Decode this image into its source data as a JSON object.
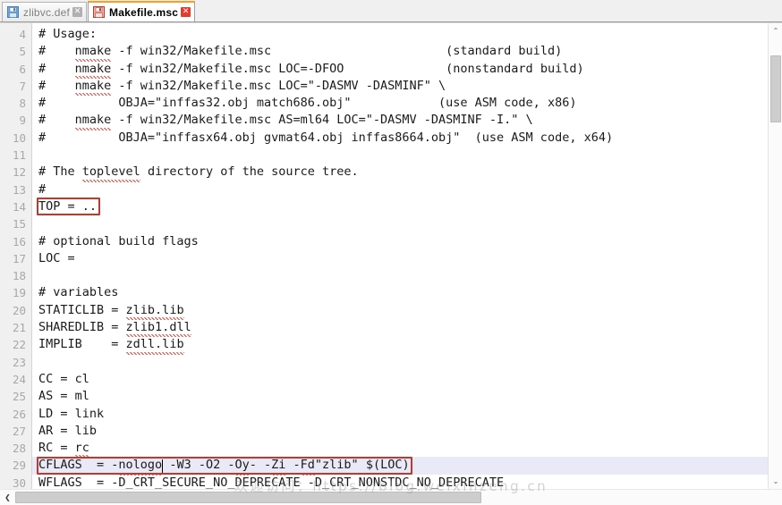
{
  "window": {
    "app_kind": "text-editor",
    "accent_active_tab": "#ff9b27",
    "annotation_color": "#c0392b",
    "current_line_color": "#e9e9f7"
  },
  "tabs": [
    {
      "label": "zlibvc.def",
      "icon": "save-disk-icon",
      "close": "✕",
      "active": false
    },
    {
      "label": "Makefile.msc",
      "icon": "save-disk-icon",
      "close": "✕",
      "active": true
    }
  ],
  "editor": {
    "first_line_number": 4,
    "current_line_number": 29,
    "lines": [
      {
        "n": 4,
        "text": "# Usage:"
      },
      {
        "n": 5,
        "text": "#    nmake -f win32/Makefile.msc                        (standard build)"
      },
      {
        "n": 6,
        "text": "#    nmake -f win32/Makefile.msc LOC=-DFOO              (nonstandard build)"
      },
      {
        "n": 7,
        "text": "#    nmake -f win32/Makefile.msc LOC=\"-DASMV -DASMINF\" \\"
      },
      {
        "n": 8,
        "text": "#          OBJA=\"inffas32.obj match686.obj\"            (use ASM code, x86)"
      },
      {
        "n": 9,
        "text": "#    nmake -f win32/Makefile.msc AS=ml64 LOC=\"-DASMV -DASMINF -I.\" \\"
      },
      {
        "n": 10,
        "text": "#          OBJA=\"inffasx64.obj gvmat64.obj inffas8664.obj\"  (use ASM code, x64)"
      },
      {
        "n": 11,
        "text": ""
      },
      {
        "n": 12,
        "text": "# The toplevel directory of the source tree."
      },
      {
        "n": 13,
        "text": "#"
      },
      {
        "n": 14,
        "text": "TOP = .."
      },
      {
        "n": 15,
        "text": ""
      },
      {
        "n": 16,
        "text": "# optional build flags"
      },
      {
        "n": 17,
        "text": "LOC ="
      },
      {
        "n": 18,
        "text": ""
      },
      {
        "n": 19,
        "text": "# variables"
      },
      {
        "n": 20,
        "text": "STATICLIB = zlib.lib"
      },
      {
        "n": 21,
        "text": "SHAREDLIB = zlib1.dll"
      },
      {
        "n": 22,
        "text": "IMPLIB    = zdll.lib"
      },
      {
        "n": 23,
        "text": ""
      },
      {
        "n": 24,
        "text": "CC = cl"
      },
      {
        "n": 25,
        "text": "AS = ml"
      },
      {
        "n": 26,
        "text": "LD = link"
      },
      {
        "n": 27,
        "text": "AR = lib"
      },
      {
        "n": 28,
        "text": "RC = rc"
      },
      {
        "n": 29,
        "text": "CFLAGS  = -nologo -W3 -O2 -Oy- -Zi -Fd\"zlib\" $(LOC)"
      },
      {
        "n": 30,
        "text": "WFLAGS  = -D_CRT_SECURE_NO_DEPRECATE -D_CRT_NONSTDC_NO_DEPRECATE"
      }
    ],
    "misspelled_words": [
      "nmake",
      "msc",
      "toplevel",
      "zlib.lib",
      "zlib1.dll",
      "zdll.lib",
      "rc",
      "nologo",
      "Oy",
      "Zi",
      "Fd"
    ],
    "annotations": [
      {
        "name": "top-variable-highlight",
        "target_line": 14,
        "text": "TOP = .."
      },
      {
        "name": "cflags-line-highlight",
        "target_line": 29,
        "text": "CFLAGS  = -nologo -W3 -O2 -Oy- -Zi -Fd\"zlib\" $(LOC)"
      }
    ]
  },
  "scrollbars": {
    "vertical": {
      "up_arrow": "⌃",
      "down_arrow": "⌄"
    },
    "horizontal": {
      "left_arrow": "❮",
      "right_arrow": "❯"
    }
  },
  "watermark": {
    "text": "欢迎访问：https://blog.weixinzeng.cn"
  }
}
